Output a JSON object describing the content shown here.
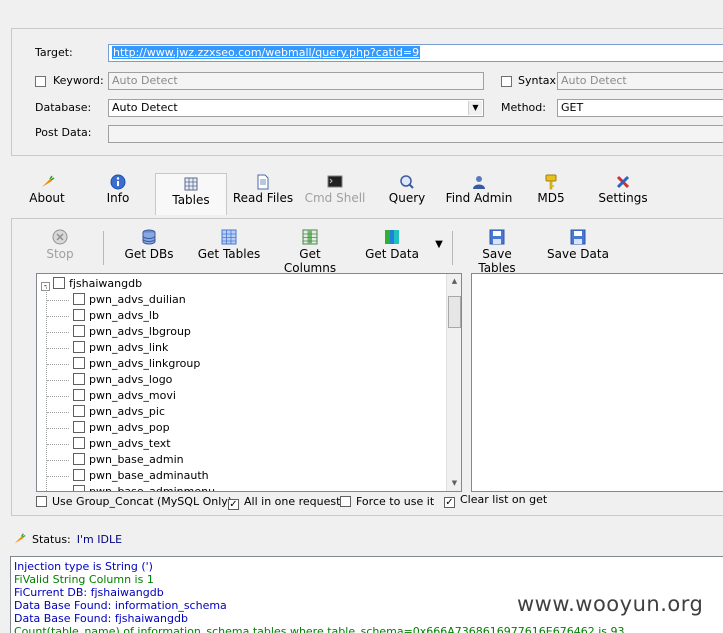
{
  "form": {
    "target_label": "Target:",
    "target_value": "http://www.jwz.zzxseo.com/webmall/query.php?catid=9",
    "keyword_label": "Keyword:",
    "keyword_value": "Auto Detect",
    "syntax_label": "Syntax:",
    "syntax_value": "Auto Detect",
    "database_label": "Database:",
    "database_value": "Auto Detect",
    "method_label": "Method:",
    "method_value": "GET",
    "postdata_label": "Post Data:",
    "postdata_value": ""
  },
  "tabs": [
    {
      "label": "About",
      "icon": "carrot-icon"
    },
    {
      "label": "Info",
      "icon": "info-icon"
    },
    {
      "label": "Tables",
      "icon": "table-icon"
    },
    {
      "label": "Read Files",
      "icon": "file-icon"
    },
    {
      "label": "Cmd Shell",
      "icon": "terminal-icon"
    },
    {
      "label": "Query",
      "icon": "query-icon"
    },
    {
      "label": "Find Admin",
      "icon": "user-icon"
    },
    {
      "label": "MD5",
      "icon": "key-icon"
    },
    {
      "label": "Settings",
      "icon": "tools-icon"
    }
  ],
  "toolbar": {
    "stop": "Stop",
    "get_dbs": "Get DBs",
    "get_tables": "Get Tables",
    "get_columns": "Get Columns",
    "get_data": "Get Data",
    "save_tables": "Save Tables",
    "save_data": "Save Data"
  },
  "tree": {
    "root": "fjshaiwangdb",
    "items": [
      "pwn_advs_duilian",
      "pwn_advs_lb",
      "pwn_advs_lbgroup",
      "pwn_advs_link",
      "pwn_advs_linkgroup",
      "pwn_advs_logo",
      "pwn_advs_movi",
      "pwn_advs_pic",
      "pwn_advs_pop",
      "pwn_advs_text",
      "pwn_base_admin",
      "pwn_base_adminauth",
      "pwn_base_adminmenu"
    ]
  },
  "options": {
    "group_concat": "Use Group_Concat (MySQL Only)",
    "all_in_one": "All in one request.",
    "force": "Force to use it",
    "clear_list": "Clear list on get"
  },
  "status": {
    "label": "Status:",
    "value": "I'm IDLE"
  },
  "log": [
    {
      "text": "Injection type is String (')",
      "color": "#0000c0"
    },
    {
      "text": "FiValid String Column is 1",
      "color": "#008000"
    },
    {
      "text": "FiCurrent DB: fjshaiwangdb",
      "color": "#0000c0"
    },
    {
      "text": "Data Base Found: information_schema",
      "color": "#0000c0"
    },
    {
      "text": "Data Base Found: fjshaiwangdb",
      "color": "#0000c0"
    },
    {
      "text": "Count(table_name) of information_schema.tables where table_schema=0x666A7368616977616E676462 is 93",
      "color": "#008000"
    }
  ],
  "watermark": "www.wooyun.org"
}
